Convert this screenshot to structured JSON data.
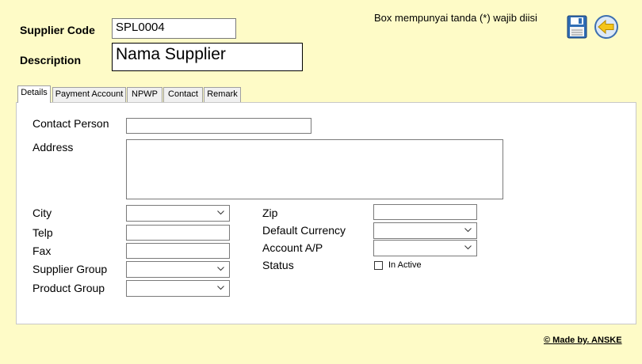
{
  "header": {
    "supplier_code_label": "Supplier Code",
    "supplier_code_value": "SPL0004",
    "description_label": "Description",
    "description_value": "Nama Supplier",
    "required_notice": "Box mempunyai tanda (*) wajib diisi"
  },
  "toolbar": {
    "save_icon": "save-icon",
    "back_icon": "back-arrow-icon"
  },
  "tabs": [
    {
      "label": "Details",
      "active": true
    },
    {
      "label": "Payment Account",
      "active": false
    },
    {
      "label": "NPWP",
      "active": false
    },
    {
      "label": "Contact",
      "active": false
    },
    {
      "label": "Remark",
      "active": false
    }
  ],
  "details": {
    "contact_person_label": "Contact Person",
    "contact_person_value": "",
    "address_label": "Address",
    "address_value": "",
    "city_label": "City",
    "city_value": "",
    "telp_label": "Telp",
    "telp_value": "",
    "fax_label": "Fax",
    "fax_value": "",
    "supplier_group_label": "Supplier Group",
    "supplier_group_value": "",
    "product_group_label": "Product Group",
    "product_group_value": "",
    "zip_label": "Zip",
    "zip_value": "",
    "default_currency_label": "Default Currency",
    "default_currency_value": "",
    "account_ap_label": "Account A/P",
    "account_ap_value": "",
    "status_label": "Status",
    "in_active_label": "In Active",
    "in_active_checked": false
  },
  "footer": {
    "made_by": "© Made by. ANSKE"
  },
  "colors": {
    "background": "#fefbc7",
    "panel": "#ffffff",
    "save_icon_blue": "#2f6db5",
    "back_icon_yellow": "#f5c518"
  }
}
